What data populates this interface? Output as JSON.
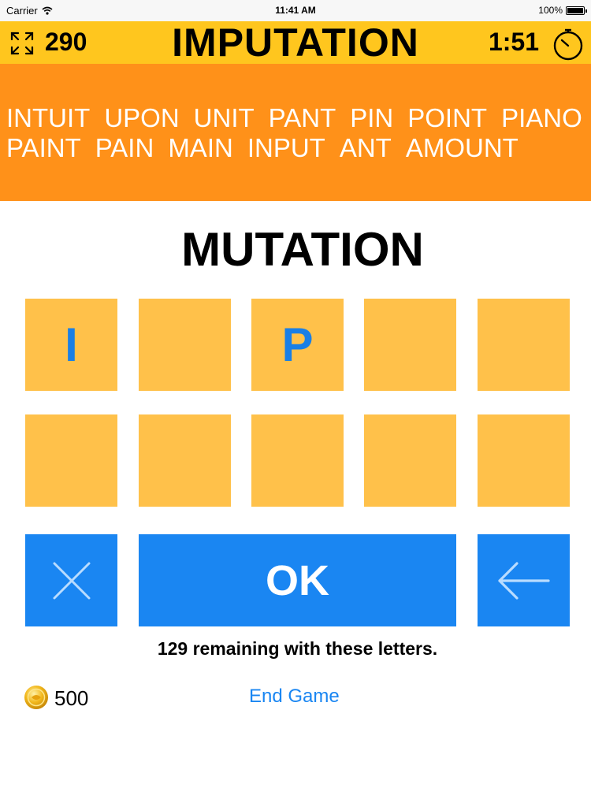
{
  "status_bar": {
    "carrier": "Carrier",
    "time": "11:41 AM",
    "battery": "100%"
  },
  "header": {
    "score": "290",
    "title": "IMPUTATION",
    "timer": "1:51",
    "expand_icon": "expand-arrows-icon",
    "clock_icon": "stopwatch-icon"
  },
  "found_words": [
    "INTUIT",
    "UPON",
    "UNIT",
    "PANT",
    "PIN",
    "POINT",
    "PIANO",
    "PAINT",
    "PAIN",
    "MAIN",
    "INPUT",
    "ANT",
    "AMOUNT"
  ],
  "current_word": "MUTATION",
  "tiles": [
    "I",
    "",
    "P",
    "",
    "",
    "",
    "",
    "",
    "",
    ""
  ],
  "buttons": {
    "clear_icon": "close-icon",
    "ok_label": "OK",
    "back_icon": "arrow-left-icon"
  },
  "remaining_text": "129 remaining with these letters.",
  "footer": {
    "coins": "500",
    "coin_icon": "coin-icon",
    "end_game_label": "End Game"
  },
  "colors": {
    "header": "#ffc61e",
    "found_panel": "#ff9119",
    "tile": "#ffc14a",
    "tile_letter": "#1a7fe6",
    "button": "#1a86f2"
  }
}
